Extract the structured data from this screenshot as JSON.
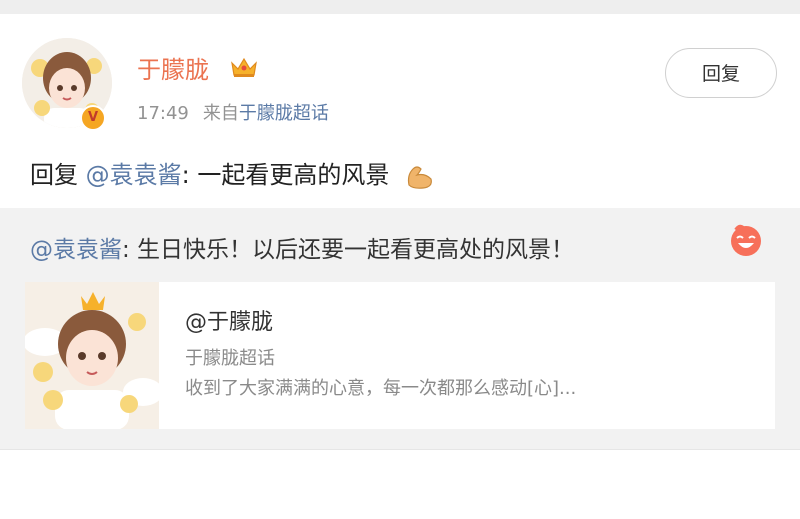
{
  "post": {
    "author": "于朦胧",
    "time": "17:49",
    "source_prefix": "来自",
    "source": "于朦胧超话",
    "reply_button": "回复",
    "text_prefix": "回复",
    "mention": "@袁袁酱",
    "text": ": 一起看更高的风景",
    "icons": {
      "crown": "crown-icon",
      "verified": "verified-badge-icon",
      "emoji": "flexed-biceps-emoji"
    }
  },
  "quoted": {
    "mention": "@袁袁酱",
    "text": ": 生日快乐！以后还要一起看更高处的风景！",
    "emoji": "laughing-face-emoji",
    "card": {
      "title": "@于朦胧",
      "subtitle": "于朦胧超话",
      "description": "收到了大家满满的心意，每一次都那么感动[心]..."
    }
  },
  "colors": {
    "author": "#eb7350",
    "link": "#5b7aa6",
    "meta": "#939393",
    "quote_bg": "#f2f2f2"
  }
}
